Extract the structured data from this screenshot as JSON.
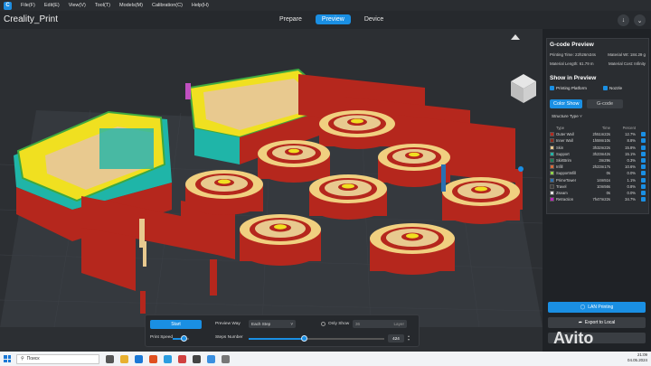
{
  "menu": {
    "items": [
      "File(F)",
      "Edit(E)",
      "View(V)",
      "Tool(T)",
      "Models(M)",
      "Calibration(C)",
      "Help(H)"
    ]
  },
  "app": {
    "title": "Creality_Print"
  },
  "tabs": [
    "Prepare",
    "Preview",
    "Device"
  ],
  "active_tab": "Preview",
  "gcode": {
    "title": "G-code Preview",
    "printing_time": "Printing Time: 22h26m34s",
    "material_wt": "Material Wt: 184.29 g",
    "material_length": "Material Length: 61.79 m",
    "material_cost": "Material Cost: Infinity"
  },
  "show": {
    "title": "Show in Preview",
    "printing_platform": "Printing Platform",
    "nozzle": "Nozzle"
  },
  "color_show": {
    "active": "Color Show",
    "inactive": "G-code"
  },
  "structure": {
    "dropdown": "Structure Type",
    "headers": [
      "Type",
      "Time",
      "Percent"
    ],
    "rows": [
      {
        "name": "Outer Wall",
        "time": "2h51m22s",
        "percent": "12.7%",
        "color": "#b5271d"
      },
      {
        "name": "Inner Wall",
        "time": "1h59m10s",
        "percent": "8.8%",
        "color": "#8a2a1c"
      },
      {
        "name": "Skin",
        "time": "3h32m22s",
        "percent": "15.8%",
        "color": "#e8c98f"
      },
      {
        "name": "Support",
        "time": "3h23m42s",
        "percent": "15.1%",
        "color": "#1fb5a8"
      },
      {
        "name": "SkirtBrim",
        "time": "3m29s",
        "percent": "0.3%",
        "color": "#1a7c58"
      },
      {
        "name": "Infill",
        "time": "2h23m17s",
        "percent": "10.6%",
        "color": "#d96a3a"
      },
      {
        "name": "SupportInfill",
        "time": "0s",
        "percent": "0.0%",
        "color": "#8fd14a"
      },
      {
        "name": "PrimeTower",
        "time": "14m51s",
        "percent": "1.1%",
        "color": "#2a6fb0"
      },
      {
        "name": "Travel",
        "time": "10m56s",
        "percent": "0.8%",
        "color": "#3a3a3a"
      },
      {
        "name": "Zseam",
        "time": "0s",
        "percent": "0.0%",
        "color": "#e0e0e0"
      },
      {
        "name": "Retraction",
        "time": "7h47m22s",
        "percent": "34.7%",
        "color": "#c020c0"
      }
    ]
  },
  "controls": {
    "start": "Start",
    "preview_way_label": "Preview Way",
    "preview_way_value": "Each Step",
    "only_show": "Only Show",
    "only_show_value": "36",
    "layer": "Layer",
    "print_speed": "Print Speed",
    "steps_number": "Steps Number",
    "steps_value": "424",
    "print_speed_fraction": 0.72,
    "steps_fraction": 0.41
  },
  "actions": {
    "lan_printing": "LAN Printing",
    "export_local": "Export to Local"
  },
  "taskbar": {
    "search": "Поиск",
    "time": "21:09",
    "date": "04.05.2024"
  },
  "watermark": "Avito",
  "colors": {
    "accent": "#1a8fe3",
    "wall_red": "#b5271d",
    "support_teal": "#1fb5a8",
    "skin_tan": "#e8c98f",
    "yellow": "#f0e020",
    "green": "#3fa83f"
  }
}
